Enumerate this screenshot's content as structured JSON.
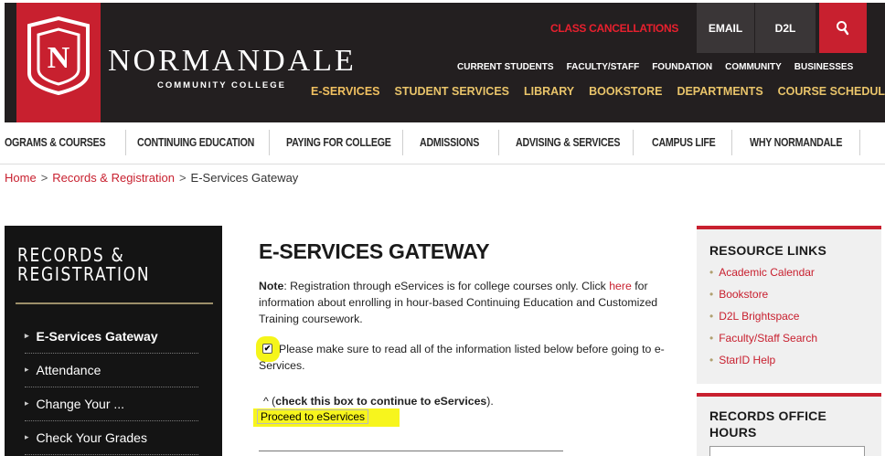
{
  "header": {
    "brand_name": "Normandale",
    "brand_sub": "COMMUNITY COLLEGE",
    "utility": {
      "cancellations": "CLASS CANCELLATIONS",
      "email": "EMAIL",
      "d2l": "D2L",
      "search_icon": "search-icon"
    },
    "audience": [
      "CURRENT STUDENTS",
      "FACULTY/STAFF",
      "FOUNDATION",
      "COMMUNITY",
      "BUSINESSES"
    ],
    "quicknav": [
      "E-SERVICES",
      "STUDENT SERVICES",
      "LIBRARY",
      "BOOKSTORE",
      "DEPARTMENTS",
      "COURSE SCHEDULES"
    ]
  },
  "mainnav": [
    "OGRAMS & COURSES",
    "CONTINUING EDUCATION",
    "PAYING FOR COLLEGE",
    "ADMISSIONS",
    "ADVISING & SERVICES",
    "CAMPUS LIFE",
    "WHY NORMANDALE"
  ],
  "breadcrumb": {
    "home": "Home",
    "section": "Records & Registration",
    "current": "E-Services Gateway",
    "sep": ">"
  },
  "sidebar": {
    "title_line1": "RECORDS &",
    "title_line2": "REGISTRATION",
    "items": [
      {
        "label": "E-Services Gateway",
        "active": true
      },
      {
        "label": "Attendance",
        "active": false
      },
      {
        "label": "Change Your ...",
        "active": false
      },
      {
        "label": "Check Your Grades",
        "active": false
      }
    ]
  },
  "content": {
    "title": "E-SERVICES GATEWAY",
    "note_label": "Note",
    "note_part1": ": Registration through eServices is for college courses only. Click ",
    "note_link": "here",
    "note_part2": " for information about enrolling in hour-based Continuing Education and Customized Training coursework.",
    "checkbox_checked": true,
    "checkbox_text": "Please make sure to read all of the information listed below before going to e-Services.",
    "hint_caret": "^ (",
    "hint_bold": "check this box to continue to eServices",
    "hint_end": ").",
    "proceed_button": "Proceed to eServices"
  },
  "resource_links": {
    "title": "RESOURCE LINKS",
    "items": [
      "Academic Calendar",
      "Bookstore",
      "D2L Brightspace",
      "Faculty/Staff Search",
      "StarID Help"
    ]
  },
  "records_hours": {
    "title": "RECORDS OFFICE HOURS"
  },
  "colors": {
    "brand_red": "#c8202f",
    "header_black": "#231f20",
    "highlight_yellow": "#f5f51a"
  }
}
